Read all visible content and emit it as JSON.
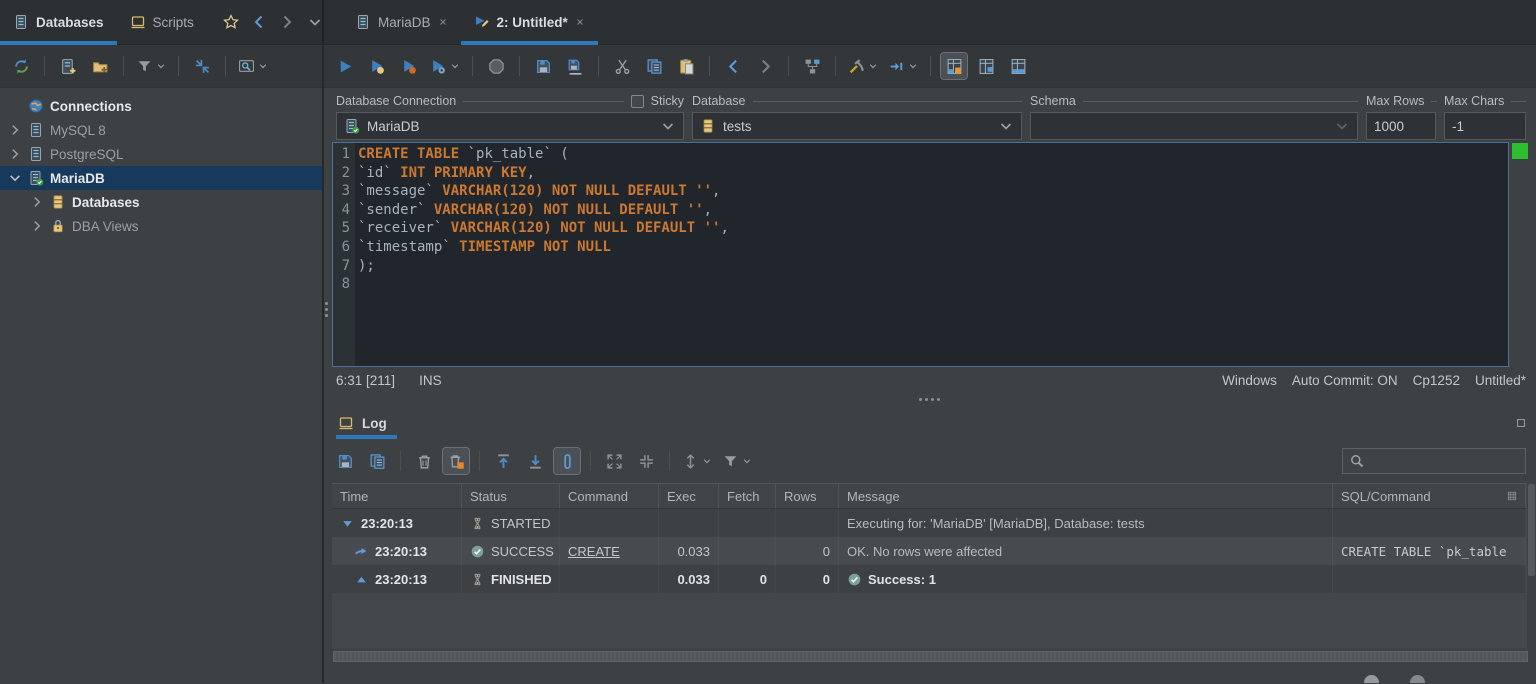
{
  "colors": {
    "accent": "#2e78bb",
    "selection_bg": "#16395c",
    "keyword_orange": "#cc7832",
    "editor_bg": "#20262b",
    "ok_indicator_green": "#2ebf2e",
    "toggle_orange": "#e8862e",
    "icon_yellow": "#e8c87e",
    "success_badge": "#79a29c"
  },
  "left_tabs": [
    {
      "label": "Databases",
      "icon": "server",
      "active": true
    },
    {
      "label": "Scripts",
      "icon": "scripts",
      "active": false
    }
  ],
  "tab_nav": [
    {
      "name": "bookmarks-button",
      "icon": "star"
    },
    {
      "name": "navigate-back-button",
      "icon": "chev-left"
    },
    {
      "name": "navigate-forward-button",
      "icon": "chev-right-dim"
    },
    {
      "name": "tab-history-dropdown",
      "icon": "chev-down"
    }
  ],
  "editor_tabs": [
    {
      "label": "MariaDB",
      "icon": "server",
      "active": false
    },
    {
      "label": "2: Untitled*",
      "icon": "sql-commander",
      "active": true
    }
  ],
  "left_toolbar": [
    {
      "name": "refresh-button",
      "icon": "refresh"
    },
    {
      "sep": true
    },
    {
      "name": "create-connection-button",
      "icon": "server-plus"
    },
    {
      "name": "create-folder-button",
      "icon": "folder-plus"
    },
    {
      "sep": true
    },
    {
      "name": "filter-connections-button",
      "icon": "funnel",
      "dropdown": true
    },
    {
      "sep": true
    },
    {
      "name": "collapse-all-button",
      "icon": "collapse-all"
    },
    {
      "sep": true
    },
    {
      "name": "find-object-button",
      "icon": "window-search",
      "dropdown": true
    }
  ],
  "editor_toolbar": [
    {
      "name": "execute-button",
      "icon": "play"
    },
    {
      "name": "execute-current-button",
      "icon": "play-yellow"
    },
    {
      "name": "execute-buffer-button",
      "icon": "play-orange"
    },
    {
      "name": "execute-options-button",
      "icon": "play-gear",
      "dropdown": true
    },
    {
      "sep": true
    },
    {
      "name": "stop-button",
      "icon": "stop"
    },
    {
      "sep": true
    },
    {
      "name": "save-button",
      "icon": "floppy"
    },
    {
      "name": "save-as-button",
      "icon": "floppy-as"
    },
    {
      "sep": true
    },
    {
      "name": "cut-button",
      "icon": "scissors"
    },
    {
      "name": "copy-button",
      "icon": "copy"
    },
    {
      "name": "paste-button",
      "icon": "paste"
    },
    {
      "sep": true
    },
    {
      "name": "back-button",
      "icon": "chev-left"
    },
    {
      "name": "forward-button",
      "icon": "chev-right-dim"
    },
    {
      "sep": true
    },
    {
      "name": "explain-plan-button",
      "icon": "graph"
    },
    {
      "sep": true
    },
    {
      "name": "tools-button",
      "icon": "tools",
      "dropdown": true
    },
    {
      "name": "continue-on-error-button",
      "icon": "skip",
      "dropdown": true
    },
    {
      "sep": true
    },
    {
      "name": "log-view-grid-button",
      "icon": "table-log1",
      "active": true
    },
    {
      "name": "log-view-text-button",
      "icon": "table-log2"
    },
    {
      "name": "log-view-both-button",
      "icon": "table-log3"
    }
  ],
  "connection_bar": {
    "connection_label": "Database Connection",
    "sticky_label": "Sticky",
    "sticky_checked": false,
    "database_label": "Database",
    "schema_label": "Schema",
    "max_rows_label": "Max Rows",
    "max_chars_label": "Max Chars",
    "connection_value": "MariaDB",
    "database_value": "tests",
    "schema_value": "",
    "max_rows_value": "1000",
    "max_chars_value": "-1"
  },
  "tree": {
    "root": {
      "label": "Connections",
      "icon": "globe"
    },
    "items": [
      {
        "label": "MySQL 8",
        "icon": "server",
        "chev": "right",
        "dim": true,
        "indent": 0
      },
      {
        "label": "PostgreSQL",
        "icon": "server",
        "chev": "right",
        "dim": true,
        "indent": 0
      },
      {
        "label": "MariaDB",
        "icon": "server-check",
        "chev": "down",
        "selected": true,
        "bold": true,
        "indent": 0
      },
      {
        "label": "Databases",
        "icon": "db-yellow",
        "chev": "right",
        "bold": true,
        "indent": 1
      },
      {
        "label": "DBA Views",
        "icon": "lock",
        "chev": "right",
        "dim": true,
        "indent": 1
      }
    ]
  },
  "editor": {
    "lines": [
      {
        "n": 1,
        "segs": [
          {
            "c": "k",
            "t": "CREATE TABLE"
          },
          {
            "c": "p",
            "t": " `pk_table` ("
          }
        ]
      },
      {
        "n": 2,
        "segs": [
          {
            "c": "p",
            "t": "`id` "
          },
          {
            "c": "k",
            "t": "INT PRIMARY KEY"
          },
          {
            "c": "p",
            "t": ","
          }
        ]
      },
      {
        "n": 3,
        "segs": [
          {
            "c": "p",
            "t": "`message` "
          },
          {
            "c": "k",
            "t": "VARCHAR(120) NOT NULL DEFAULT"
          },
          {
            "c": "s",
            "t": " ''"
          },
          {
            "c": "p",
            "t": ","
          }
        ]
      },
      {
        "n": 4,
        "segs": [
          {
            "c": "p",
            "t": "`sender` "
          },
          {
            "c": "k",
            "t": "VARCHAR(120) NOT NULL DEFAULT"
          },
          {
            "c": "s",
            "t": " ''"
          },
          {
            "c": "p",
            "t": ","
          }
        ]
      },
      {
        "n": 5,
        "segs": [
          {
            "c": "p",
            "t": "`receiver` "
          },
          {
            "c": "k",
            "t": "VARCHAR(120) NOT NULL DEFAULT"
          },
          {
            "c": "s",
            "t": " ''"
          },
          {
            "c": "p",
            "t": ","
          }
        ]
      },
      {
        "n": 6,
        "segs": [
          {
            "c": "p",
            "t": "`timestamp` "
          },
          {
            "c": "k",
            "t": "TIMESTAMP NOT NULL"
          }
        ]
      },
      {
        "n": 7,
        "segs": [
          {
            "c": "p",
            "t": ");"
          }
        ]
      },
      {
        "n": 8,
        "segs": []
      }
    ]
  },
  "status_bar": {
    "position": "6:31 [211]",
    "mode": "INS",
    "platform": "Windows",
    "auto_commit": "Auto Commit: ON",
    "encoding": "Cp1252",
    "file": "Untitled*"
  },
  "log": {
    "tab_label": "Log",
    "search_value": "",
    "toolbar": [
      {
        "name": "export-log-button",
        "icon": "floppy"
      },
      {
        "name": "copy-log-button",
        "icon": "copy"
      },
      {
        "sep": true
      },
      {
        "name": "clear-log-button",
        "icon": "trash"
      },
      {
        "name": "auto-clear-log-button",
        "icon": "trash-orange",
        "active": true
      },
      {
        "sep": true
      },
      {
        "name": "scroll-to-top-button",
        "icon": "up-line"
      },
      {
        "name": "scroll-to-bottom-button",
        "icon": "down-line"
      },
      {
        "name": "tail-log-button",
        "icon": "capsule",
        "active": true
      },
      {
        "sep": true
      },
      {
        "name": "expand-all-button",
        "icon": "expand"
      },
      {
        "name": "collapse-rows-button",
        "icon": "collapse-in"
      },
      {
        "sep": true
      },
      {
        "name": "row-height-button",
        "icon": "vdist",
        "dropdown": true
      },
      {
        "name": "filter-log-button",
        "icon": "funnel",
        "dropdown": true
      }
    ],
    "columns": [
      "Time",
      "Status",
      "Command",
      "Exec",
      "Fetch",
      "Rows",
      "Message",
      "SQL/Command"
    ],
    "rows": [
      {
        "alt": false,
        "indent": false,
        "bold": false,
        "expand": "tri-down",
        "time": "23:20:13",
        "status_icon": "hourglass",
        "status": "STARTED",
        "command": "",
        "command_link": false,
        "exec": "",
        "fetch": "",
        "rows": "",
        "msg_icon": "",
        "message": "Executing for: 'MariaDB' [MariaDB], Database: tests",
        "sql": ""
      },
      {
        "alt": true,
        "indent": true,
        "bold": false,
        "expand": "arrow-right",
        "time": "23:20:13",
        "status_icon": "check-circle",
        "status": "SUCCESS",
        "command": "CREATE",
        "command_link": true,
        "exec": "0.033",
        "fetch": "",
        "rows": "0",
        "msg_icon": "",
        "message": "OK. No rows were affected",
        "sql": "CREATE TABLE `pk_table"
      },
      {
        "alt": false,
        "indent": true,
        "bold": true,
        "expand": "tri-up",
        "time": "23:20:13",
        "status_icon": "hourglass",
        "status": "FINISHED",
        "command": "",
        "command_link": false,
        "exec": "0.033",
        "fetch": "0",
        "rows": "0",
        "msg_icon": "check-circle",
        "message": "Success: 1",
        "sql": ""
      }
    ]
  }
}
